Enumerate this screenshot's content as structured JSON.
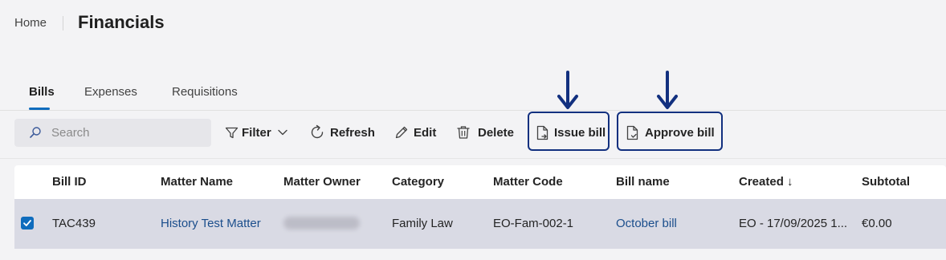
{
  "header": {
    "breadcrumb_home": "Home",
    "title": "Financials"
  },
  "tabs": [
    {
      "label": "Bills",
      "active": true
    },
    {
      "label": "Expenses",
      "active": false
    },
    {
      "label": "Requisitions",
      "active": false
    }
  ],
  "toolbar": {
    "search_placeholder": "Search",
    "search_value": "",
    "filter_label": "Filter",
    "refresh_label": "Refresh",
    "edit_label": "Edit",
    "delete_label": "Delete",
    "issue_bill_label": "Issue bill",
    "approve_bill_label": "Approve bill"
  },
  "table": {
    "columns": [
      "Bill ID",
      "Matter Name",
      "Matter Owner",
      "Category",
      "Matter Code",
      "Bill name",
      "Created ↓",
      "Subtotal"
    ],
    "rows": [
      {
        "selected": true,
        "bill_id": "TAC439",
        "matter_name": "History Test Matter",
        "matter_owner": "",
        "category": "Family Law",
        "matter_code": "EO-Fam-002-1",
        "bill_name": "October bill",
        "created": "EO - 17/09/2025 1...",
        "subtotal": "€0.00"
      }
    ]
  },
  "colors": {
    "accent": "#0f6cbd",
    "highlight": "#12307f",
    "link": "#1b4e8c",
    "selected_row": "#d9dae4"
  },
  "icons": {
    "search": "search-icon",
    "filter": "filter-icon",
    "refresh": "refresh-icon",
    "edit": "pencil-icon",
    "delete": "trash-icon",
    "issue_bill": "document-arrow-icon",
    "approve_bill": "document-check-icon",
    "annotation": "arrow-down-icon"
  }
}
